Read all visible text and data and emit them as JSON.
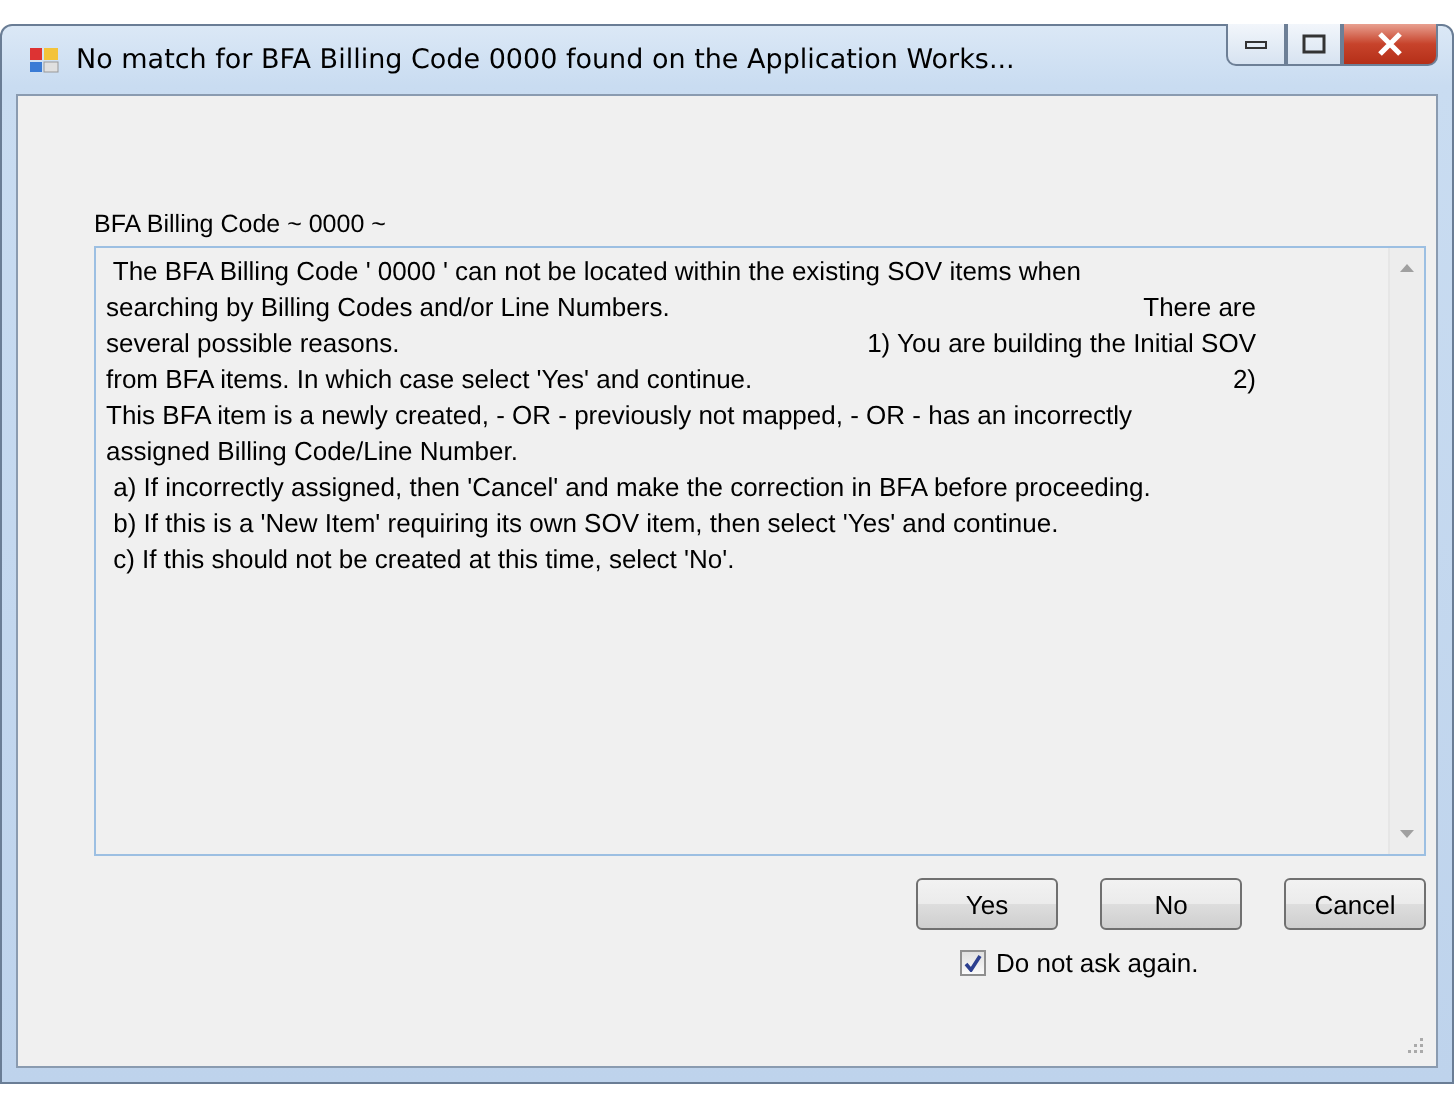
{
  "window": {
    "title": "No match for BFA Billing Code 0000  found on the Application Works..."
  },
  "field_label": "BFA Billing Code ~ 0000 ~",
  "message_lines": [
    {
      "left": " The BFA Billing Code ' 0000 ' can not be located within the existing SOV items when"
    },
    {
      "left": "searching by Billing Codes and/or Line Numbers.",
      "right": "There are"
    },
    {
      "left": "several possible reasons.",
      "right": "1) You are building the Initial SOV"
    },
    {
      "left": "from BFA items. In which case select 'Yes' and continue.",
      "right": "2)"
    },
    {
      "left": "This BFA item is a newly created, - OR - previously not mapped, - OR - has an incorrectly"
    },
    {
      "left": "assigned Billing Code/Line Number."
    },
    {
      "left": " a) If incorrectly assigned, then 'Cancel' and make the correction in BFA before proceeding."
    },
    {
      "left": " b) If this is a 'New Item' requiring its own SOV item, then select 'Yes' and continue."
    },
    {
      "left": " c) If this should not be created at this time, select 'No'."
    }
  ],
  "buttons": [
    "Yes",
    "No",
    "Cancel"
  ],
  "do_not_ask": {
    "label": "Do not ask again.",
    "checked": true
  }
}
